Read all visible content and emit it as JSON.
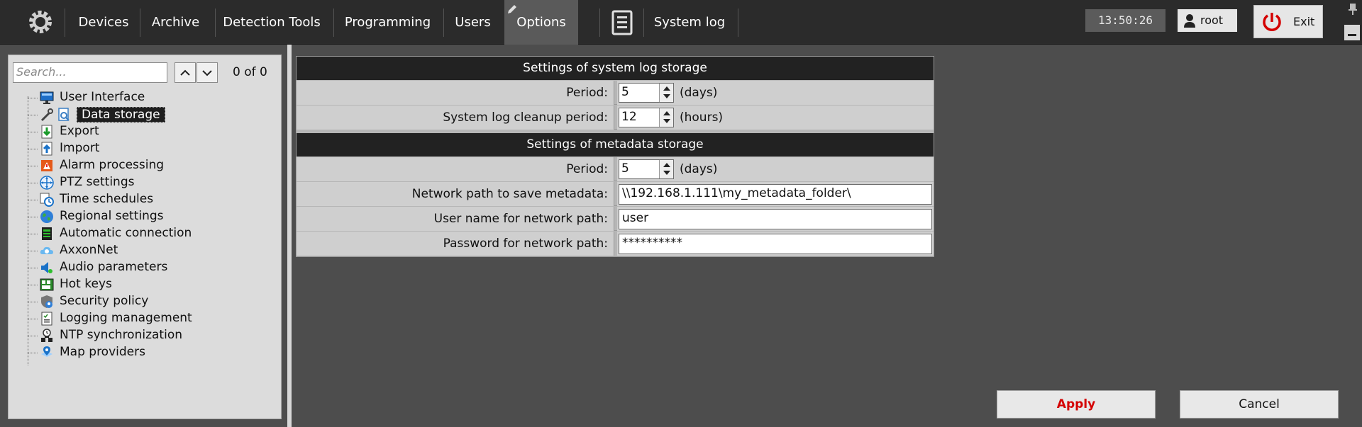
{
  "topbar": {
    "tabs": [
      {
        "label": "Devices"
      },
      {
        "label": "Archive"
      },
      {
        "label": "Detection Tools"
      },
      {
        "label": "Programming"
      },
      {
        "label": "Users"
      },
      {
        "label": "Options"
      }
    ],
    "active_tab": "Options",
    "system_log_label": "System log",
    "clock": "13:50:26",
    "user": "root",
    "exit_label": "Exit",
    "colors": {
      "bar": "#2b2b2b",
      "active_tab": "#5a5a5a",
      "exit_icon": "#d40000"
    }
  },
  "sidebar": {
    "search_placeholder": "Search...",
    "search_count": "0 of 0",
    "items": [
      {
        "label": "User Interface",
        "icon": "monitor-icon"
      },
      {
        "label": "Data storage",
        "icon": "data-storage-icon",
        "selected": true
      },
      {
        "label": "Export",
        "icon": "export-icon"
      },
      {
        "label": "Import",
        "icon": "import-icon"
      },
      {
        "label": "Alarm processing",
        "icon": "alarm-icon"
      },
      {
        "label": "PTZ settings",
        "icon": "ptz-icon"
      },
      {
        "label": "Time schedules",
        "icon": "schedule-icon"
      },
      {
        "label": "Regional settings",
        "icon": "globe-icon"
      },
      {
        "label": "Automatic connection",
        "icon": "connection-icon"
      },
      {
        "label": "AxxonNet",
        "icon": "cloud-icon"
      },
      {
        "label": "Audio parameters",
        "icon": "audio-icon"
      },
      {
        "label": "Hot keys",
        "icon": "keyboard-icon"
      },
      {
        "label": "Security policy",
        "icon": "shield-icon"
      },
      {
        "label": "Logging management",
        "icon": "log-icon"
      },
      {
        "label": "NTP synchronization",
        "icon": "ntp-icon"
      },
      {
        "label": "Map providers",
        "icon": "map-icon"
      }
    ]
  },
  "settings": {
    "syslog_title": "Settings of system log storage",
    "syslog_period_label": "Period:",
    "syslog_period_value": "5",
    "syslog_period_unit": "(days)",
    "cleanup_label": "System log cleanup period:",
    "cleanup_value": "12",
    "cleanup_unit": "(hours)",
    "meta_title": "Settings of metadata storage",
    "meta_period_label": "Period:",
    "meta_period_value": "5",
    "meta_period_unit": "(days)",
    "netpath_label": "Network path to save metadata:",
    "netpath_value": "\\\\192.168.1.111\\my_metadata_folder\\",
    "username_label": "User name for network path:",
    "username_value": "user",
    "password_label": "Password for network path:",
    "password_value": "**********"
  },
  "actions": {
    "apply": "Apply",
    "cancel": "Cancel",
    "apply_color": "#d40000"
  }
}
